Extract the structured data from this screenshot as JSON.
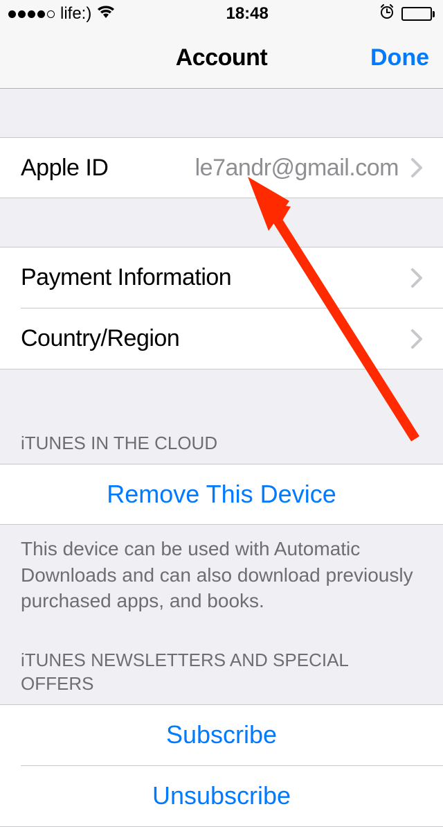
{
  "status_bar": {
    "carrier": "life:)",
    "time": "18:48"
  },
  "nav": {
    "title": "Account",
    "done": "Done"
  },
  "apple_id": {
    "label": "Apple ID",
    "value": "le7andr@gmail.com"
  },
  "rows": {
    "payment": "Payment Information",
    "country": "Country/Region"
  },
  "itunes_cloud": {
    "header": "iTUNES IN THE CLOUD",
    "remove": "Remove This Device",
    "footer": "This device can be used with Automatic Downloads and can also download previously purchased apps, and books."
  },
  "newsletters": {
    "header": "iTUNES NEWSLETTERS AND SPECIAL OFFERS",
    "subscribe": "Subscribe",
    "unsubscribe": "Unsubscribe"
  }
}
